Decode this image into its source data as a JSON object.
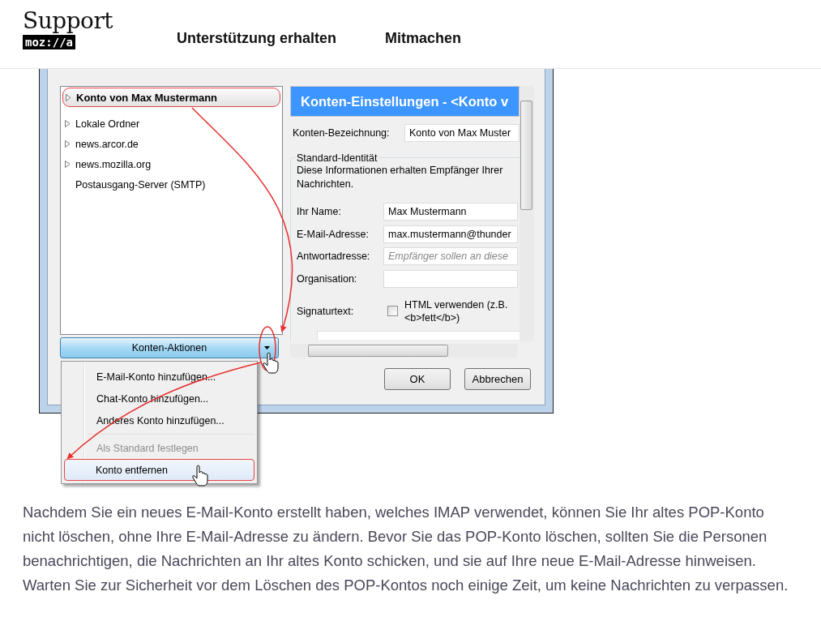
{
  "header": {
    "logo_title": "Support",
    "logo_badge": "moz://a",
    "nav": [
      {
        "label": "Unterstützung erhalten"
      },
      {
        "label": "Mitmachen"
      }
    ]
  },
  "dialog": {
    "accounts": [
      {
        "label": "Konto von Max Mustermann",
        "selected": true,
        "expandable": true
      },
      {
        "label": "Lokale Ordner",
        "selected": false,
        "expandable": true
      },
      {
        "label": "news.arcor.de",
        "selected": false,
        "expandable": true
      },
      {
        "label": "news.mozilla.org",
        "selected": false,
        "expandable": true
      },
      {
        "label": "Postausgang-Server (SMTP)",
        "selected": false,
        "expandable": false
      }
    ],
    "actions_button": "Konten-Aktionen",
    "panel_title": "Konten-Einstellungen - <Konto v",
    "account_name": {
      "label": "Konten-Bezeichnung:",
      "value": "Konto von Max Muster"
    },
    "identity": {
      "legend": "Standard-Identität",
      "description": "Diese Informationen erhalten Empfänger Ihrer Nachrichten.",
      "fields": [
        {
          "label": "Ihr Name:",
          "value": "Max Mustermann"
        },
        {
          "label": "E-Mail-Adresse:",
          "value": "max.mustermann@thunder"
        },
        {
          "label": "Antwortadresse:",
          "placeholder": "Empfänger sollen an diese"
        },
        {
          "label": "Organisation:"
        }
      ],
      "signature": {
        "label": "Signaturtext:",
        "checkbox_label": "HTML verwenden (z.B. <b>fett</b>)",
        "checked": false
      }
    },
    "buttons": [
      "OK",
      "Abbrechen"
    ],
    "menu": [
      {
        "kind": "item",
        "label": "E-Mail-Konto hinzufügen...",
        "disabled": false,
        "selected": false
      },
      {
        "kind": "item",
        "label": "Chat-Konto hinzufügen...",
        "disabled": false,
        "selected": false
      },
      {
        "kind": "item",
        "label": "Anderes Konto hinzufügen...",
        "disabled": false,
        "selected": false
      },
      {
        "kind": "separator"
      },
      {
        "kind": "item",
        "label": "Als Standard festlegen",
        "disabled": true,
        "selected": false
      },
      {
        "kind": "item",
        "label": "Konto entfernen",
        "disabled": false,
        "selected": true
      }
    ]
  },
  "article": "Nachdem Sie ein neues E-Mail-Konto erstellt haben, welches IMAP verwendet, können Sie Ihr altes POP-Konto nicht löschen, ohne Ihre E-Mail-Adresse zu ändern. Bevor Sie das POP-Konto löschen, sollten Sie die Personen benachrichtigen, die Nachrichten an Ihr altes Konto schicken, und sie auf Ihre neue E-Mail-Adresse hinweisen. Warten Sie zur Sicherheit vor dem Löschen des POP-Kontos noch einige Zeit, um keine Nachrichten zu verpassen."
}
